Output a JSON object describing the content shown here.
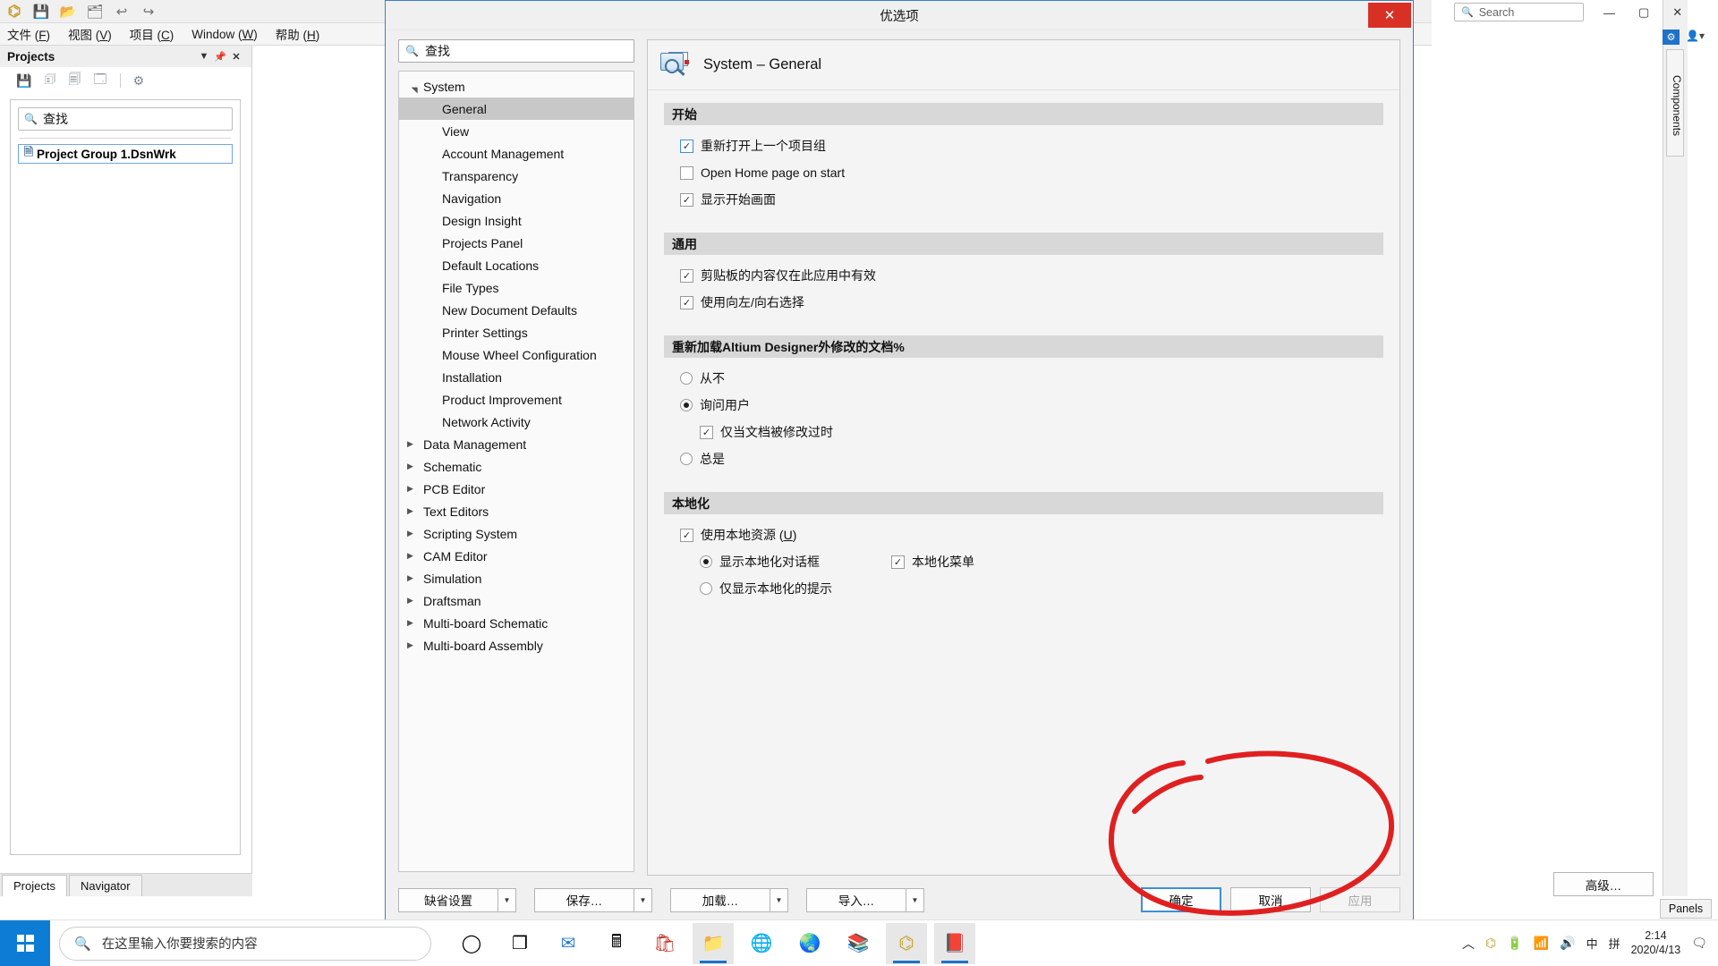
{
  "app": {
    "toolbar_icons": [
      "altium-logo",
      "save-icon",
      "open-folder-icon",
      "open-document-icon",
      "undo-icon",
      "redo-icon"
    ],
    "menus": [
      {
        "label": "文件",
        "accel": "F"
      },
      {
        "label": "视图",
        "accel": "V"
      },
      {
        "label": "项目",
        "accel": "C"
      },
      {
        "label": "Window",
        "accel": "W"
      },
      {
        "label": "帮助",
        "accel": "H"
      }
    ],
    "projects_panel": {
      "title": "Projects",
      "header_icons": [
        "chevron-down-icon",
        "pin-icon",
        "close-icon"
      ],
      "toolbar_icons": [
        "save-icon",
        "copy-icon",
        "compile-icon",
        "project-options-icon",
        "gear-icon"
      ],
      "search_placeholder": "查找",
      "item_label": "Project Group 1.DsnWrk",
      "tabs": [
        {
          "label": "Projects",
          "active": true
        },
        {
          "label": "Navigator",
          "active": false
        }
      ]
    },
    "right_side": {
      "components_tab": "Components",
      "panels_tab": "Panels"
    },
    "window_search_placeholder": "Search",
    "caption_buttons": [
      "minimize",
      "maximize",
      "close"
    ]
  },
  "dialog": {
    "title": "优选项",
    "close_label": "✕",
    "search_placeholder": "查找",
    "tree": [
      {
        "label": "System",
        "level": 0,
        "expanded": true,
        "selected": false
      },
      {
        "label": "General",
        "level": 1,
        "selected": true
      },
      {
        "label": "View",
        "level": 1,
        "selected": false
      },
      {
        "label": "Account Management",
        "level": 1,
        "selected": false
      },
      {
        "label": "Transparency",
        "level": 1,
        "selected": false
      },
      {
        "label": "Navigation",
        "level": 1,
        "selected": false
      },
      {
        "label": "Design Insight",
        "level": 1,
        "selected": false
      },
      {
        "label": "Projects Panel",
        "level": 1,
        "selected": false
      },
      {
        "label": "Default Locations",
        "level": 1,
        "selected": false
      },
      {
        "label": "File Types",
        "level": 1,
        "selected": false
      },
      {
        "label": "New Document Defaults",
        "level": 1,
        "selected": false
      },
      {
        "label": "Printer Settings",
        "level": 1,
        "selected": false
      },
      {
        "label": "Mouse Wheel Configuration",
        "level": 1,
        "selected": false
      },
      {
        "label": "Installation",
        "level": 1,
        "selected": false
      },
      {
        "label": "Product Improvement",
        "level": 1,
        "selected": false
      },
      {
        "label": "Network Activity",
        "level": 1,
        "selected": false
      },
      {
        "label": "Data Management",
        "level": 0,
        "expanded": false,
        "selected": false
      },
      {
        "label": "Schematic",
        "level": 0,
        "expanded": false,
        "selected": false
      },
      {
        "label": "PCB Editor",
        "level": 0,
        "expanded": false,
        "selected": false
      },
      {
        "label": "Text Editors",
        "level": 0,
        "expanded": false,
        "selected": false
      },
      {
        "label": "Scripting System",
        "level": 0,
        "expanded": false,
        "selected": false
      },
      {
        "label": "CAM Editor",
        "level": 0,
        "expanded": false,
        "selected": false
      },
      {
        "label": "Simulation",
        "level": 0,
        "expanded": false,
        "selected": false
      },
      {
        "label": "Draftsman",
        "level": 0,
        "expanded": false,
        "selected": false
      },
      {
        "label": "Multi-board Schematic",
        "level": 0,
        "expanded": false,
        "selected": false
      },
      {
        "label": "Multi-board Assembly",
        "level": 0,
        "expanded": false,
        "selected": false
      }
    ],
    "content": {
      "page_title": "System – General",
      "page_icon": "system-general-icon",
      "sections": [
        {
          "heading": "开始",
          "options": [
            {
              "type": "checkbox",
              "label": "重新打开上一个项目组",
              "checked": true,
              "focused": true
            },
            {
              "type": "checkbox",
              "label": "Open Home page on start",
              "checked": false,
              "focused": false
            },
            {
              "type": "checkbox",
              "label": "显示开始画面",
              "checked": true,
              "focused": false
            }
          ]
        },
        {
          "heading": "通用",
          "options": [
            {
              "type": "checkbox",
              "label": "剪贴板的内容仅在此应用中有效",
              "checked": true,
              "focused": false
            },
            {
              "type": "checkbox",
              "label": "使用向左/向右选择",
              "checked": true,
              "focused": false
            }
          ]
        },
        {
          "heading": "重新加载Altium Designer外修改的文档%",
          "options": [
            {
              "type": "radio",
              "label": "从不",
              "checked": false
            },
            {
              "type": "radio",
              "label": "询问用户",
              "checked": true
            },
            {
              "type": "checkbox",
              "label": "仅当文档被修改过时",
              "checked": true,
              "indent": true
            },
            {
              "type": "radio",
              "label": "总是",
              "checked": false
            }
          ]
        },
        {
          "heading": "本地化",
          "options": [
            {
              "type": "checkbox",
              "label": "使用本地资源 (U)",
              "checked": true,
              "accel": "U"
            },
            {
              "type": "radio",
              "label": "显示本地化对话框",
              "checked": true,
              "indent": true
            },
            {
              "type": "checkbox",
              "label": "本地化菜单",
              "checked": true,
              "right_column": true
            },
            {
              "type": "radio",
              "label": "仅显示本地化的提示",
              "checked": false,
              "indent": true
            }
          ]
        }
      ],
      "advanced_button": "高级…"
    },
    "footer": {
      "left_buttons": [
        {
          "label": "缺省设置",
          "has_dropdown": true
        },
        {
          "label": "保存…",
          "has_dropdown": true
        },
        {
          "label": "加载…",
          "has_dropdown": true
        },
        {
          "label": "导入…",
          "has_dropdown": true
        }
      ],
      "ok": "确定",
      "cancel": "取消",
      "apply": "应用",
      "apply_disabled": true
    }
  },
  "taskbar": {
    "search_placeholder": "在这里输入你要搜索的内容",
    "apps": [
      "cortana-icon",
      "task-view-icon",
      "mail-icon",
      "calculator-icon",
      "store-icon",
      "file-explorer-icon",
      "edge-icon",
      "chrome-icon",
      "library-icon",
      "altium-icon",
      "altium-designer-icon"
    ],
    "tray_icons": [
      "chevron-up-icon",
      "altium-tray-icon",
      "battery-icon",
      "wifi-icon",
      "volume-icon"
    ],
    "ime": "中",
    "ime2": "拼",
    "clock_time": "2:14",
    "clock_date": "2020/4/13",
    "notification_icon": "notification-icon"
  },
  "colors": {
    "dialog_border": "#3d7fc1",
    "close_red": "#d93025",
    "section_header_bg": "#d8d8d8",
    "selected_tree_bg": "#c8c8c8",
    "focus_blue": "#3d8fd6",
    "annotation_red": "#e02020",
    "taskbar_blue": "#0c7cd5"
  }
}
